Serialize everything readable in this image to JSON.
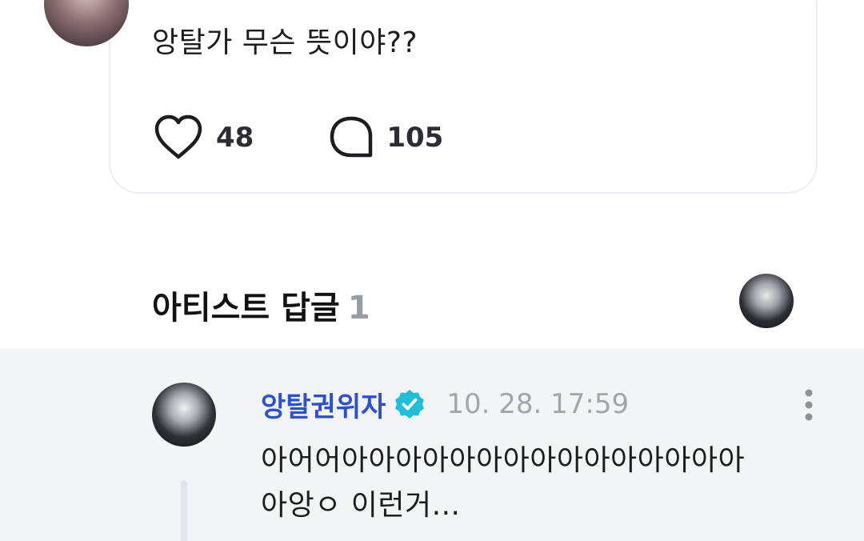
{
  "post": {
    "text": "앙탈가 무슨 뜻이야??",
    "likes": "48",
    "comments": "105"
  },
  "section": {
    "title": "아티스트 답글",
    "count": "1"
  },
  "reply": {
    "author": "앙탈권위자",
    "timestamp": "10. 28. 17:59",
    "line1": "아어어아아아아아아아아아아아아아아아",
    "line2": "아앙ㅇ 이런거..."
  },
  "colors": {
    "author_name": "#2c4fd6",
    "verified_badge": "#1fbfd6",
    "reply_background": "#f3f4f6"
  },
  "icons": {
    "like": "heart-icon",
    "comment": "speech-bubble-icon",
    "verified": "verified-badge-icon",
    "more": "more-vertical-icon"
  }
}
